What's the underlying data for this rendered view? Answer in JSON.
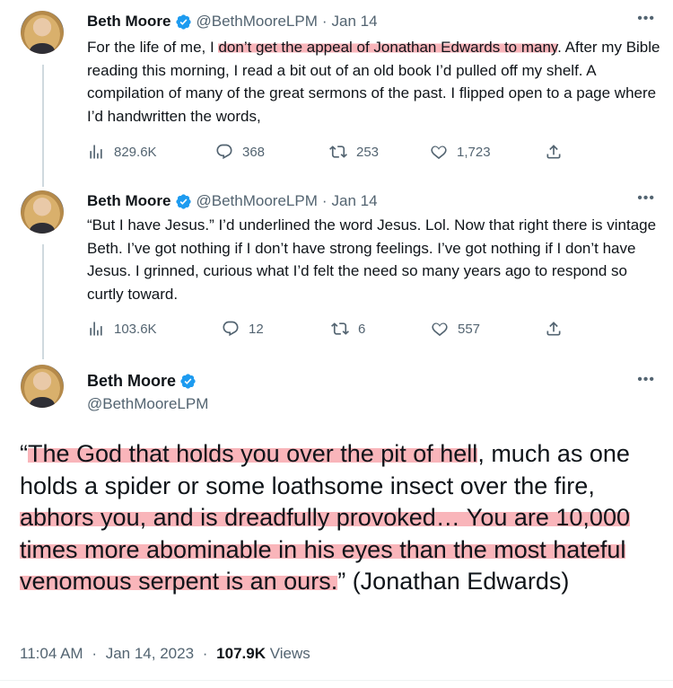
{
  "tweets": [
    {
      "name": "Beth Moore",
      "handle": "@BethMooreLPM",
      "separator": "·",
      "date": "Jan 14",
      "text_parts": [
        {
          "text": "For the life of me, I ",
          "highlight": false
        },
        {
          "text": "don’t get the appeal of Jonathan Edwards to many",
          "highlight": true
        },
        {
          "text": ". After my Bible reading this morning, I read a bit out of an old book I’d pulled off my shelf. A compilation of many of the great sermons of the past. I flipped open to a page where I’d handwritten the words,",
          "highlight": false
        }
      ],
      "metrics": {
        "views": "829.6K",
        "replies": "368",
        "retweets": "253",
        "likes": "1,723"
      }
    },
    {
      "name": "Beth Moore",
      "handle": "@BethMooreLPM",
      "separator": "·",
      "date": "Jan 14",
      "text_parts": [
        {
          "text": "“But I have Jesus.” I’d underlined the word Jesus. Lol. Now that right there is vintage Beth. I’ve got nothing if I don’t have strong feelings. I’ve got nothing if I don’t have Jesus. I grinned, curious what I’d felt the need so many years ago to respond so curtly toward.",
          "highlight": false
        }
      ],
      "metrics": {
        "views": "103.6K",
        "replies": "12",
        "retweets": "6",
        "likes": "557"
      }
    }
  ],
  "main_tweet": {
    "name": "Beth Moore",
    "handle": "@BethMooreLPM",
    "text_parts": [
      {
        "text": "“",
        "highlight": false
      },
      {
        "text": "The God that holds you over the pit of hell",
        "highlight": true
      },
      {
        "text": ", much as one holds a spider or some loathsome insect over the fire, ",
        "highlight": false
      },
      {
        "text": "abhors you, and is dreadfully provoked… You are 10,000 times more abominable in his eyes than the most hateful venomous serpent is an ours.",
        "highlight": true
      },
      {
        "text": "” (Jonathan Edwards)",
        "highlight": false
      }
    ],
    "time": "11:04 AM",
    "separator": "·",
    "date": "Jan 14, 2023",
    "views_count": "107.9K",
    "views_label": "Views"
  },
  "icons": {
    "verified": "verified-badge-icon",
    "more": "more-options-icon",
    "views": "analytics-icon",
    "reply": "reply-icon",
    "retweet": "retweet-icon",
    "like": "heart-icon",
    "share": "share-icon"
  },
  "colors": {
    "verified_blue": "#1d9bf0",
    "secondary_text": "#536471",
    "highlight": "#f47882",
    "thread_line": "#cfd9de"
  }
}
